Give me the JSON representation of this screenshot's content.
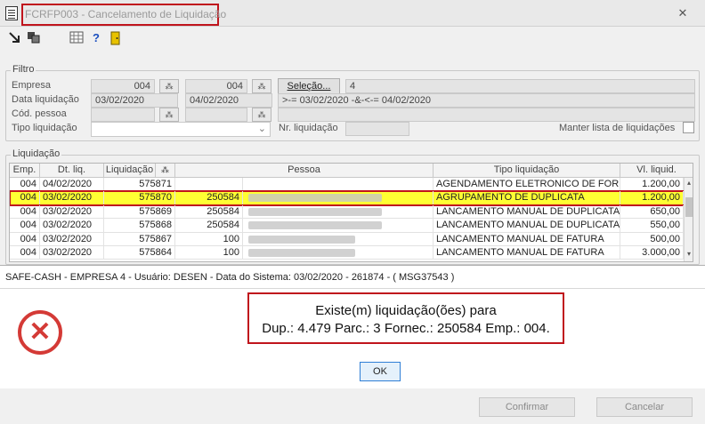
{
  "window": {
    "title": "FCRFP003 - Cancelamento de Liquidação",
    "close_glyph": "✕"
  },
  "toolbar": {
    "icons": [
      "exit-icon",
      "copy-icon",
      "calculator-icon",
      "help-icon",
      "door-icon"
    ],
    "help_glyph": "?"
  },
  "filtro": {
    "legend": "Filtro",
    "empresa_label": "Empresa",
    "empresa_from": "004",
    "empresa_to": "004",
    "selecao_label": "Seleção...",
    "selecao_value": "4",
    "data_label": "Data liquidação",
    "data_from": "03/02/2020",
    "data_to": "04/02/2020",
    "data_expr": ">-= 03/02/2020 -&-<-= 04/02/2020",
    "pessoa_label": "Cód. pessoa",
    "tipo_label": "Tipo liquidação",
    "nr_label": "Nr. liquidação",
    "manter_label": "Manter lista de liquidações"
  },
  "liquidacao": {
    "legend": "Liquidação",
    "headers": {
      "emp": "Emp.",
      "dt": "Dt. liq.",
      "liq": "Liquidação",
      "pessoa": "Pessoa",
      "tipo": "Tipo liquidação",
      "vl": "Vl. liquid."
    },
    "rows": [
      {
        "emp": "004",
        "dt": "04/02/2020",
        "liq": "575871",
        "pessoa": "",
        "tipo": "AGENDAMENTO ELETRONICO DE FORNEC",
        "vl": "1.200,00"
      },
      {
        "emp": "004",
        "dt": "03/02/2020",
        "liq": "575870",
        "pessoa": "250584",
        "tipo": "AGRUPAMENTO DE DUPLICATA",
        "vl": "1.200,00"
      },
      {
        "emp": "004",
        "dt": "03/02/2020",
        "liq": "575869",
        "pessoa": "250584",
        "tipo": "LANCAMENTO MANUAL DE DUPLICATA",
        "vl": "650,00"
      },
      {
        "emp": "004",
        "dt": "03/02/2020",
        "liq": "575868",
        "pessoa": "250584",
        "tipo": "LANCAMENTO MANUAL DE DUPLICATA",
        "vl": "550,00"
      },
      {
        "emp": "004",
        "dt": "03/02/2020",
        "liq": "575867",
        "pessoa": "100",
        "tipo": "LANCAMENTO MANUAL DE FATURA",
        "vl": "500,00"
      },
      {
        "emp": "004",
        "dt": "03/02/2020",
        "liq": "575864",
        "pessoa": "100",
        "tipo": "LANCAMENTO MANUAL DE FATURA",
        "vl": "3.000,00"
      }
    ]
  },
  "dialog": {
    "title": "SAFE-CASH - EMPRESA 4 - Usuário: DESEN - Data do Sistema: 03/02/2020 - 261874 - ( MSG37543 )",
    "message_line1": "Existe(m) liquidação(ões) para",
    "message_line2": "Dup.: 4.479  Parc.: 3 Fornec.: 250584 Emp.: 004.",
    "ok_label": "OK",
    "error_glyph": "✕"
  },
  "footer": {
    "confirmar_label": "Confirmar",
    "cancelar_label": "Cancelar"
  },
  "colors": {
    "highlight": "#ffff33",
    "annotation_red": "#c0141c",
    "error_red": "#d43a36"
  }
}
